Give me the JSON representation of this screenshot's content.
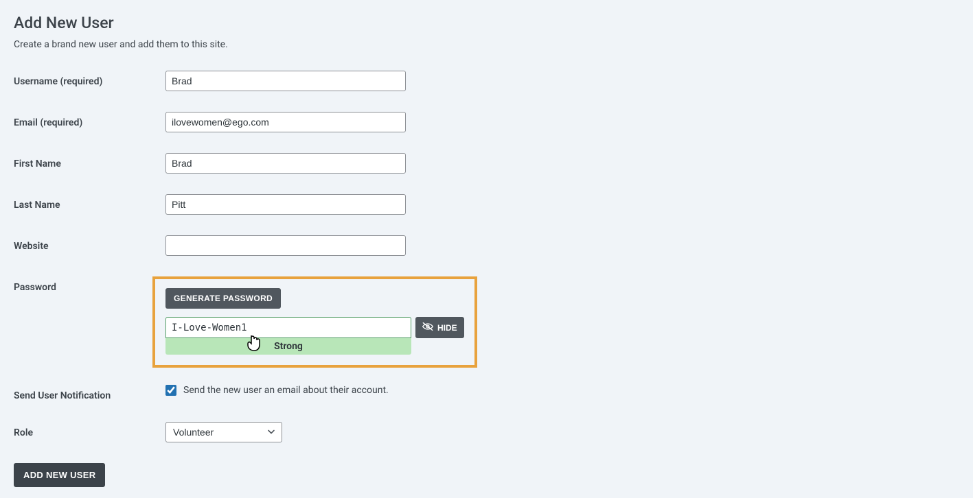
{
  "page": {
    "title": "Add New User",
    "subtitle": "Create a brand new user and add them to this site."
  },
  "labels": {
    "username": "Username (required)",
    "email": "Email (required)",
    "first_name": "First Name",
    "last_name": "Last Name",
    "website": "Website",
    "password": "Password",
    "send_notification": "Send User Notification",
    "role": "Role"
  },
  "values": {
    "username": "Brad",
    "email": "ilovewomen@ego.com",
    "first_name": "Brad",
    "last_name": "Pitt",
    "website": "",
    "password": "I-Love-Women1",
    "role_selected": "Volunteer",
    "notification_checked": true
  },
  "password_section": {
    "generate_label": "GENERATE PASSWORD",
    "hide_label": "HIDE",
    "strength_label": "Strong"
  },
  "notification_text": "Send the new user an email about their account.",
  "submit_label": "ADD NEW USER"
}
